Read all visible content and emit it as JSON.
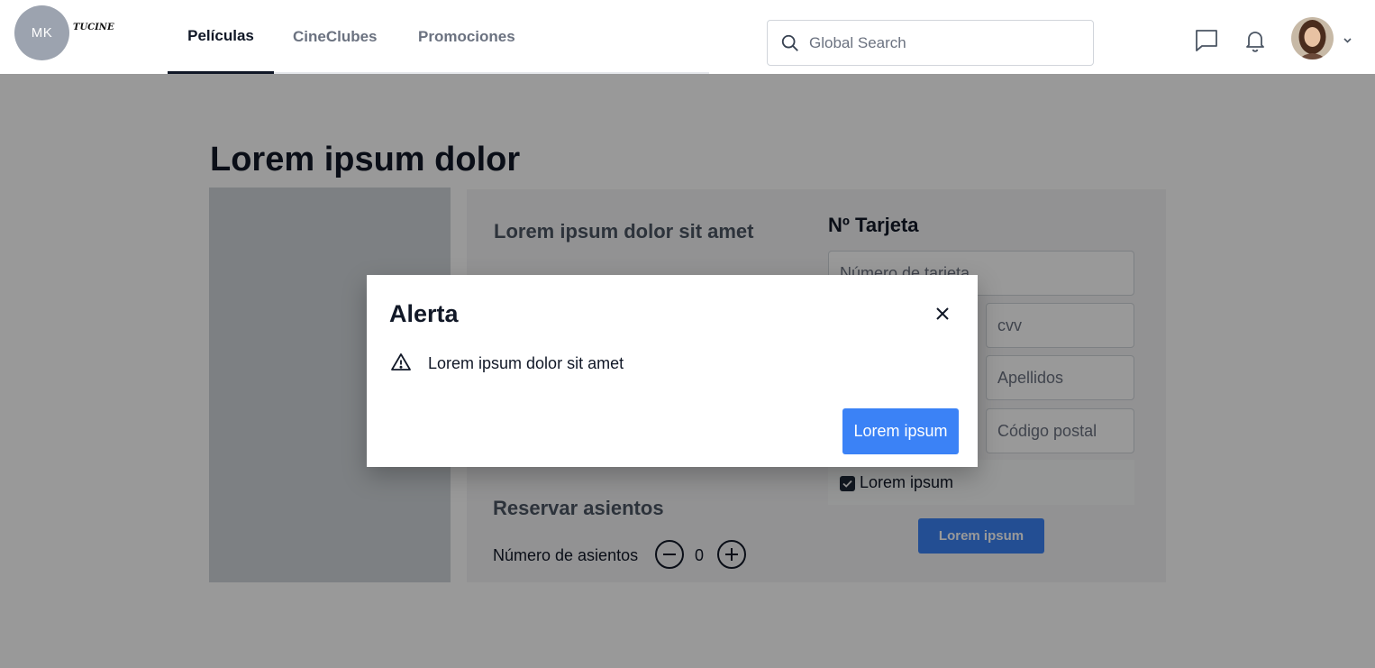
{
  "header": {
    "logo_initials": "MK",
    "brand_name": "TUCINE",
    "nav_tabs": [
      {
        "label": "Películas",
        "active": true
      },
      {
        "label": "CineClubes",
        "active": false
      },
      {
        "label": "Promociones",
        "active": false
      }
    ],
    "search": {
      "placeholder": "Global Search",
      "icon": "search-icon"
    },
    "icons": [
      "message-icon",
      "bell-icon",
      "user-avatar",
      "chevron-down-icon"
    ]
  },
  "page": {
    "title": "Lorem ipsum dolor",
    "panel_heading": "Lorem ipsum dolor sit amet",
    "seats": {
      "heading": "Reservar asientos",
      "label": "Número de asientos",
      "count": "0"
    },
    "card": {
      "heading": "Nº Tarjeta",
      "card_number_placeholder": "Número de tarjeta",
      "cvv_placeholder": "cvv",
      "surname_placeholder": "Apellidos",
      "postal_placeholder": "Código postal",
      "checkbox_label": "Lorem ipsum",
      "checkbox_checked": true,
      "submit_label": "Lorem ipsum"
    }
  },
  "modal": {
    "title": "Alerta",
    "message": "Lorem ipsum dolor sit amet",
    "button_label": "Lorem ipsum"
  },
  "colors": {
    "accent": "#3b82f6",
    "overlay": "rgba(0,0,0,0.40)"
  }
}
